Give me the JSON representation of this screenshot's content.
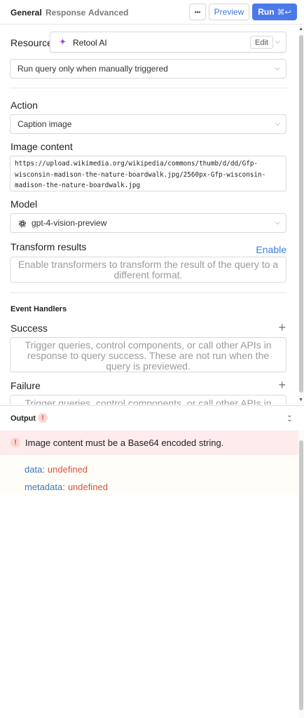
{
  "tabs": [
    {
      "label": "General",
      "active": true
    },
    {
      "label": "Response",
      "active": false
    },
    {
      "label": "Advanced",
      "active": false
    }
  ],
  "toolbar": {
    "more_label": "•••",
    "preview_label": "Preview",
    "run_label": "Run",
    "run_shortcut": "⌘↩",
    "run_color": "#4b79ea"
  },
  "resource": {
    "label": "Resource",
    "name": "Retool AI",
    "edit_label": "Edit",
    "icon": "sparkle-icon"
  },
  "trigger": {
    "value": "Run query only when manually triggered"
  },
  "action": {
    "label": "Action",
    "value": "Caption image"
  },
  "image_content": {
    "label": "Image content",
    "value": "https://upload.wikimedia.org/wikipedia/commons/thumb/d/dd/Gfp-wisconsin-madison-the-nature-boardwalk.jpg/2560px-Gfp-wisconsin-madison-the-nature-boardwalk.jpg",
    "lines": [
      "https://upload.wikimedia.org/wikipedia/commons/thumb/d/dd/Gfp-",
      "wisconsin-madison-the-nature-boardwalk.jpg/2560px-Gfp-wisconsin-",
      "madison-the-nature-boardwalk.jpg"
    ]
  },
  "model": {
    "label": "Model",
    "value": "gpt-4-vision-preview",
    "icon": "openai-icon"
  },
  "transform": {
    "label": "Transform results",
    "enable_label": "Enable",
    "placeholder": "Enable transformers to transform the result of the query to a different format."
  },
  "event_handlers": {
    "title": "Event Handlers",
    "success_label": "Success",
    "success_placeholder": "Trigger queries, control components, or call other APIs in response to query success. These are not run when the query is previewed.",
    "failure_label": "Failure",
    "failure_placeholder": "Trigger queries, control components, or call other APIs in"
  },
  "output": {
    "title": "Output",
    "error_badge": "!",
    "error_message": "Image content must be a Base64 encoded string.",
    "error_color": "#d6473a",
    "results": [
      {
        "key": "data:",
        "value": "undefined"
      },
      {
        "key": "metadata:",
        "value": "undefined"
      }
    ]
  }
}
